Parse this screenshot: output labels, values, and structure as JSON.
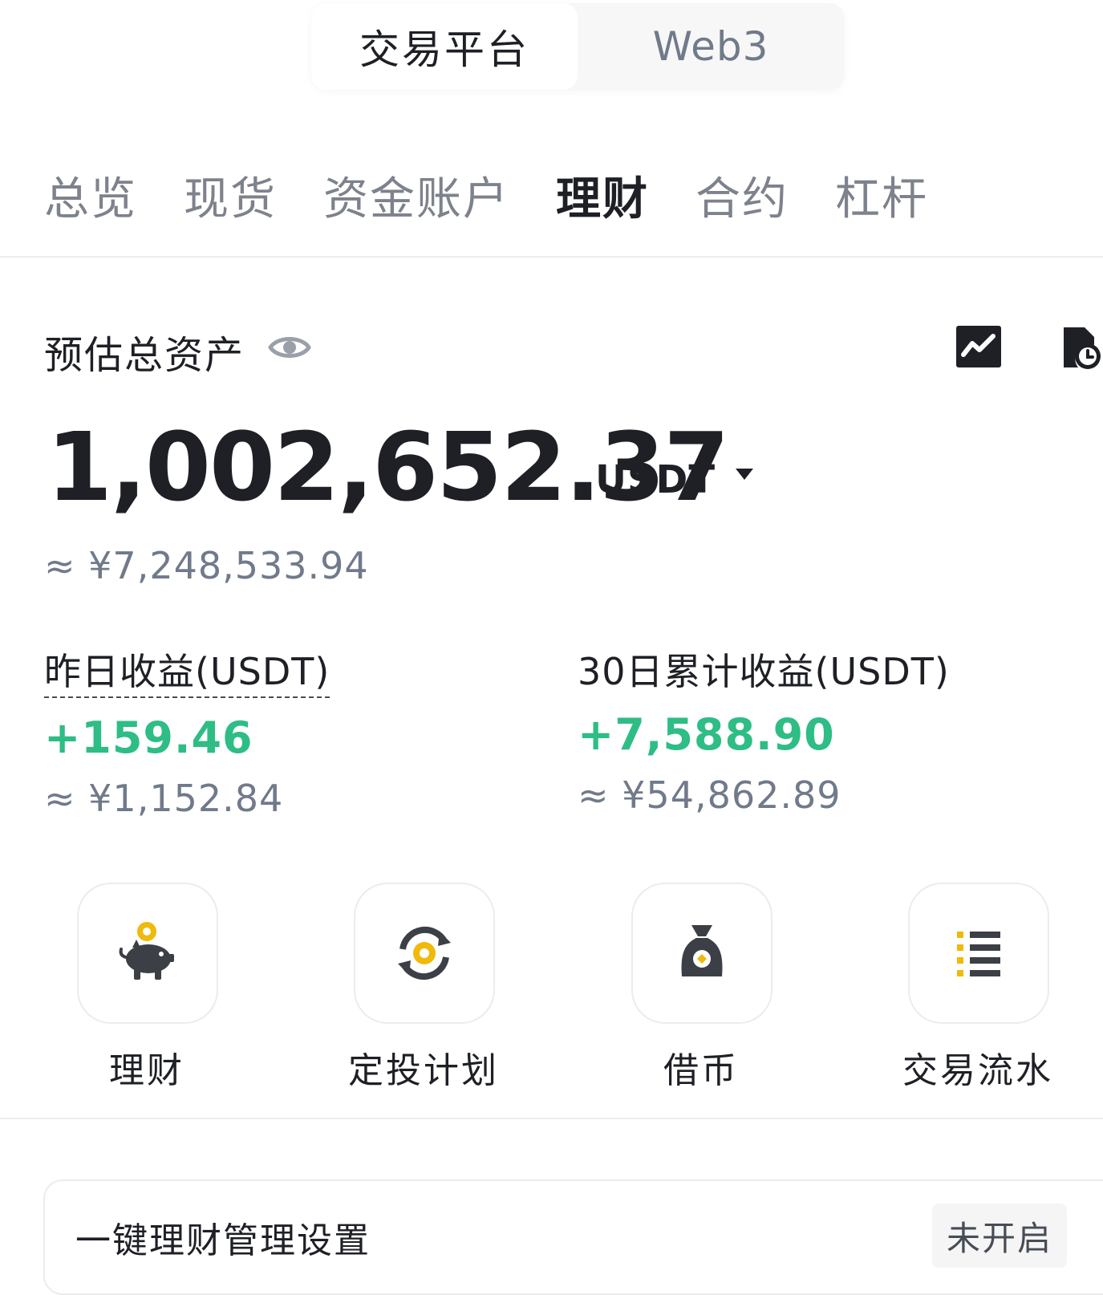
{
  "platform_switch": {
    "active": "交易平台",
    "inactive": "Web3"
  },
  "account_tabs": [
    {
      "label": "总览",
      "active": false
    },
    {
      "label": "现货",
      "active": false
    },
    {
      "label": "资金账户",
      "active": false
    },
    {
      "label": "理财",
      "active": true
    },
    {
      "label": "合约",
      "active": false
    },
    {
      "label": "杠杆",
      "active": false
    }
  ],
  "summary": {
    "label": "预估总资产",
    "total": "1,002,652.37",
    "currency": "USDT",
    "total_cny": "≈ ¥7,248,533.94"
  },
  "earnings": {
    "yesterday": {
      "label": "昨日收益(USDT)",
      "value": "+159.46",
      "cny": "≈ ¥1,152.84"
    },
    "thirty_day": {
      "label": "30日累计收益(USDT)",
      "value": "+7,588.90",
      "cny": "≈ ¥54,862.89"
    }
  },
  "quick_actions": [
    {
      "label": "理财",
      "icon": "piggy-bank-icon"
    },
    {
      "label": "定投计划",
      "icon": "recurring-coin-icon"
    },
    {
      "label": "借币",
      "icon": "money-bag-icon"
    },
    {
      "label": "交易流水",
      "icon": "transaction-list-icon"
    }
  ],
  "settings_card": {
    "title": "一键理财管理设置",
    "status": "未开启"
  },
  "colors": {
    "accent": "#f0b90b",
    "positive": "#2ebd85",
    "primary_text": "#1e2026",
    "secondary_text": "#707a8a",
    "icon_dark": "#3c3f45"
  }
}
